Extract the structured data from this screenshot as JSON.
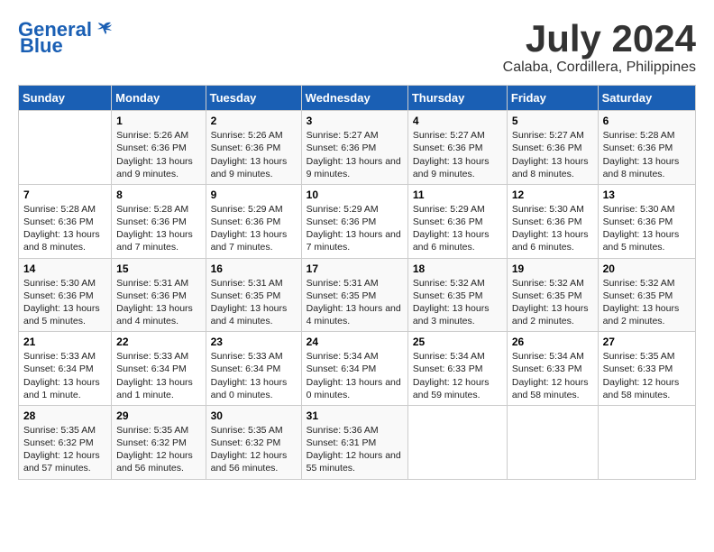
{
  "header": {
    "logo_general": "General",
    "logo_blue": "Blue",
    "month": "July 2024",
    "location": "Calaba, Cordillera, Philippines"
  },
  "days_of_week": [
    "Sunday",
    "Monday",
    "Tuesday",
    "Wednesday",
    "Thursday",
    "Friday",
    "Saturday"
  ],
  "weeks": [
    [
      {
        "day": "",
        "info": ""
      },
      {
        "day": "1",
        "info": "Sunrise: 5:26 AM\nSunset: 6:36 PM\nDaylight: 13 hours and 9 minutes."
      },
      {
        "day": "2",
        "info": "Sunrise: 5:26 AM\nSunset: 6:36 PM\nDaylight: 13 hours and 9 minutes."
      },
      {
        "day": "3",
        "info": "Sunrise: 5:27 AM\nSunset: 6:36 PM\nDaylight: 13 hours and 9 minutes."
      },
      {
        "day": "4",
        "info": "Sunrise: 5:27 AM\nSunset: 6:36 PM\nDaylight: 13 hours and 9 minutes."
      },
      {
        "day": "5",
        "info": "Sunrise: 5:27 AM\nSunset: 6:36 PM\nDaylight: 13 hours and 8 minutes."
      },
      {
        "day": "6",
        "info": "Sunrise: 5:28 AM\nSunset: 6:36 PM\nDaylight: 13 hours and 8 minutes."
      }
    ],
    [
      {
        "day": "7",
        "info": "Sunrise: 5:28 AM\nSunset: 6:36 PM\nDaylight: 13 hours and 8 minutes."
      },
      {
        "day": "8",
        "info": "Sunrise: 5:28 AM\nSunset: 6:36 PM\nDaylight: 13 hours and 7 minutes."
      },
      {
        "day": "9",
        "info": "Sunrise: 5:29 AM\nSunset: 6:36 PM\nDaylight: 13 hours and 7 minutes."
      },
      {
        "day": "10",
        "info": "Sunrise: 5:29 AM\nSunset: 6:36 PM\nDaylight: 13 hours and 7 minutes."
      },
      {
        "day": "11",
        "info": "Sunrise: 5:29 AM\nSunset: 6:36 PM\nDaylight: 13 hours and 6 minutes."
      },
      {
        "day": "12",
        "info": "Sunrise: 5:30 AM\nSunset: 6:36 PM\nDaylight: 13 hours and 6 minutes."
      },
      {
        "day": "13",
        "info": "Sunrise: 5:30 AM\nSunset: 6:36 PM\nDaylight: 13 hours and 5 minutes."
      }
    ],
    [
      {
        "day": "14",
        "info": "Sunrise: 5:30 AM\nSunset: 6:36 PM\nDaylight: 13 hours and 5 minutes."
      },
      {
        "day": "15",
        "info": "Sunrise: 5:31 AM\nSunset: 6:36 PM\nDaylight: 13 hours and 4 minutes."
      },
      {
        "day": "16",
        "info": "Sunrise: 5:31 AM\nSunset: 6:35 PM\nDaylight: 13 hours and 4 minutes."
      },
      {
        "day": "17",
        "info": "Sunrise: 5:31 AM\nSunset: 6:35 PM\nDaylight: 13 hours and 4 minutes."
      },
      {
        "day": "18",
        "info": "Sunrise: 5:32 AM\nSunset: 6:35 PM\nDaylight: 13 hours and 3 minutes."
      },
      {
        "day": "19",
        "info": "Sunrise: 5:32 AM\nSunset: 6:35 PM\nDaylight: 13 hours and 2 minutes."
      },
      {
        "day": "20",
        "info": "Sunrise: 5:32 AM\nSunset: 6:35 PM\nDaylight: 13 hours and 2 minutes."
      }
    ],
    [
      {
        "day": "21",
        "info": "Sunrise: 5:33 AM\nSunset: 6:34 PM\nDaylight: 13 hours and 1 minute."
      },
      {
        "day": "22",
        "info": "Sunrise: 5:33 AM\nSunset: 6:34 PM\nDaylight: 13 hours and 1 minute."
      },
      {
        "day": "23",
        "info": "Sunrise: 5:33 AM\nSunset: 6:34 PM\nDaylight: 13 hours and 0 minutes."
      },
      {
        "day": "24",
        "info": "Sunrise: 5:34 AM\nSunset: 6:34 PM\nDaylight: 13 hours and 0 minutes."
      },
      {
        "day": "25",
        "info": "Sunrise: 5:34 AM\nSunset: 6:33 PM\nDaylight: 12 hours and 59 minutes."
      },
      {
        "day": "26",
        "info": "Sunrise: 5:34 AM\nSunset: 6:33 PM\nDaylight: 12 hours and 58 minutes."
      },
      {
        "day": "27",
        "info": "Sunrise: 5:35 AM\nSunset: 6:33 PM\nDaylight: 12 hours and 58 minutes."
      }
    ],
    [
      {
        "day": "28",
        "info": "Sunrise: 5:35 AM\nSunset: 6:32 PM\nDaylight: 12 hours and 57 minutes."
      },
      {
        "day": "29",
        "info": "Sunrise: 5:35 AM\nSunset: 6:32 PM\nDaylight: 12 hours and 56 minutes."
      },
      {
        "day": "30",
        "info": "Sunrise: 5:35 AM\nSunset: 6:32 PM\nDaylight: 12 hours and 56 minutes."
      },
      {
        "day": "31",
        "info": "Sunrise: 5:36 AM\nSunset: 6:31 PM\nDaylight: 12 hours and 55 minutes."
      },
      {
        "day": "",
        "info": ""
      },
      {
        "day": "",
        "info": ""
      },
      {
        "day": "",
        "info": ""
      }
    ]
  ]
}
